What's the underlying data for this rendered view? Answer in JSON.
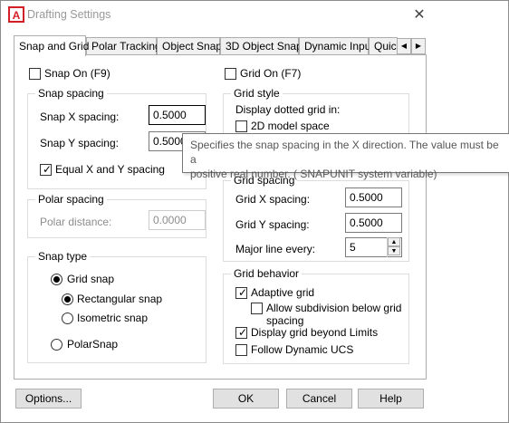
{
  "window": {
    "title": "Drafting Settings"
  },
  "tabs": [
    "Snap and Grid",
    "Polar Tracking",
    "Object Snap",
    "3D Object Snap",
    "Dynamic Input",
    "Quic"
  ],
  "snap": {
    "snap_on": "Snap On (F9)",
    "spacing_title": "Snap spacing",
    "x_label": "Snap X spacing:",
    "x_value": "0.5000",
    "y_label": "Snap Y spacing:",
    "y_value": "0.5000",
    "equal": "Equal X and Y spacing"
  },
  "polar": {
    "title": "Polar spacing",
    "distance_label": "Polar distance:",
    "distance_value": "0.0000"
  },
  "snap_type": {
    "title": "Snap type",
    "grid_snap": "Grid snap",
    "rect_snap": "Rectangular snap",
    "iso_snap": "Isometric snap",
    "polar_snap": "PolarSnap"
  },
  "grid": {
    "grid_on": "Grid On (F7)",
    "style_title": "Grid style",
    "dotted_label": "Display dotted grid in:",
    "model_space": "2D model space",
    "spacing_title": "Grid spacing",
    "x_label": "Grid X spacing:",
    "x_value": "0.5000",
    "y_label": "Grid Y spacing:",
    "y_value": "0.5000",
    "major_label": "Major line every:",
    "major_value": "5",
    "behavior_title": "Grid behavior",
    "adaptive": "Adaptive grid",
    "subdivision": "Allow subdivision below grid",
    "subdivision2": "spacing",
    "beyond": "Display grid beyond Limits",
    "follow": "Follow Dynamic UCS"
  },
  "tooltip": {
    "line1": "Specifies the snap spacing in the X direction. The value must be a",
    "line2": "positive real number. ( SNAPUNIT system variable)"
  },
  "buttons": {
    "options": "Options...",
    "ok": "OK",
    "cancel": "Cancel",
    "help": "Help"
  }
}
